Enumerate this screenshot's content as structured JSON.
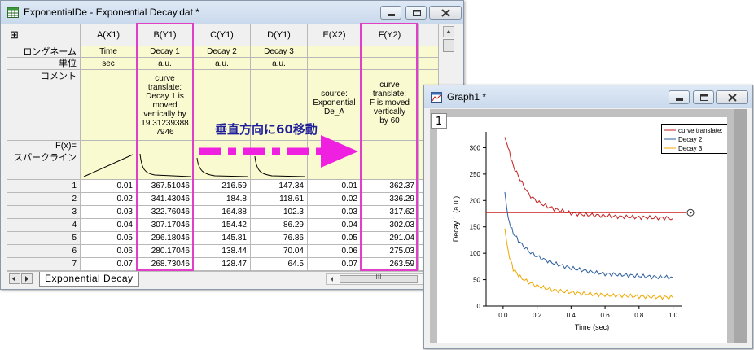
{
  "worksheet": {
    "title": "ExponentialDe - Exponential Decay.dat *",
    "corner_glyph": "⊞",
    "columns": [
      "A(X1)",
      "B(Y1)",
      "C(Y1)",
      "D(Y1)",
      "E(X2)",
      "F(Y2)"
    ],
    "row_labels": {
      "longname": "ロングネーム",
      "units": "単位",
      "comments": "コメント",
      "fx": "F(x)=",
      "sparkline": "スパークライン"
    },
    "longnames": [
      "Time",
      "Decay 1",
      "Decay 2",
      "Decay 3",
      "",
      ""
    ],
    "units": [
      "sec",
      "a.u.",
      "a.u.",
      "a.u.",
      "",
      ""
    ],
    "comments": [
      [],
      [
        "curve",
        "translate:",
        "Decay 1 is",
        "moved",
        "vertically by",
        "19.31239388",
        "7946"
      ],
      [],
      [],
      [
        "source:",
        "Exponential",
        "De_A"
      ],
      [
        "curve",
        "translate:",
        "F is moved",
        "vertically",
        "by 60"
      ]
    ],
    "rows": [
      {
        "n": "1",
        "cells": [
          "0.01",
          "367.51046",
          "216.59",
          "147.34",
          "0.01",
          "362.37"
        ]
      },
      {
        "n": "2",
        "cells": [
          "0.02",
          "341.43046",
          "184.8",
          "118.61",
          "0.02",
          "336.29"
        ]
      },
      {
        "n": "3",
        "cells": [
          "0.03",
          "322.76046",
          "164.88",
          "102.3",
          "0.03",
          "317.62"
        ]
      },
      {
        "n": "4",
        "cells": [
          "0.04",
          "307.17046",
          "154.42",
          "86.29",
          "0.04",
          "302.03"
        ]
      },
      {
        "n": "5",
        "cells": [
          "0.05",
          "296.18046",
          "145.81",
          "76.86",
          "0.05",
          "291.04"
        ]
      },
      {
        "n": "6",
        "cells": [
          "0.06",
          "280.17046",
          "138.44",
          "70.04",
          "0.06",
          "275.03"
        ]
      },
      {
        "n": "7",
        "cells": [
          "0.07",
          "268.73046",
          "128.47",
          "64.5",
          "0.07",
          "263.59"
        ]
      }
    ],
    "sheet_tab": "Exponential Decay",
    "hscroll_glyph": "III"
  },
  "annotation": {
    "text": "垂直方向に60移動",
    "text_color": "#1f1f9a",
    "arrow_color": "#f020e0"
  },
  "highlight_color": "#e040c8",
  "graph": {
    "title": "Graph1 *",
    "layer": "1",
    "chart_data": {
      "type": "line",
      "xlabel": "Time (sec)",
      "ylabel": "Decay 1 (a.u.)",
      "xlim": [
        -0.1,
        1.05
      ],
      "ylim": [
        0,
        330
      ],
      "x_ticks": [
        "0.0",
        "0.2",
        "0.4",
        "0.6",
        "0.8",
        "1.0"
      ],
      "y_ticks": [
        "0",
        "50",
        "100",
        "150",
        "200",
        "250",
        "300"
      ],
      "legend_position": "top-right",
      "hline": {
        "y": 177,
        "color": "#cc1f1f"
      },
      "series": [
        {
          "name": "curve translate:",
          "color": "#c41e1e",
          "x": [
            0.01,
            0.03,
            0.06,
            0.1,
            0.15,
            0.2,
            0.25,
            0.3,
            0.35,
            0.4,
            0.45,
            0.5,
            0.55,
            0.6,
            0.65,
            0.7,
            0.75,
            0.8,
            0.85,
            0.9,
            0.95,
            1.0
          ],
          "y": [
            320,
            300,
            265,
            240,
            212,
            198,
            190,
            184,
            180,
            176,
            174,
            173,
            172,
            171,
            170,
            169,
            169,
            168,
            168,
            167,
            167,
            166
          ]
        },
        {
          "name": "Decay 2",
          "color": "#2f5f9e",
          "x": [
            0.01,
            0.03,
            0.06,
            0.1,
            0.15,
            0.2,
            0.25,
            0.3,
            0.35,
            0.4,
            0.45,
            0.5,
            0.55,
            0.6,
            0.65,
            0.7,
            0.75,
            0.8,
            0.85,
            0.9,
            0.95,
            1.0
          ],
          "y": [
            216,
            165,
            138,
            120,
            104,
            94,
            87,
            81,
            76,
            72,
            69,
            66,
            63,
            61,
            60,
            59,
            58,
            57,
            56,
            55,
            55,
            54
          ]
        },
        {
          "name": "Decay 3",
          "color": "#f0a800",
          "x": [
            0.01,
            0.03,
            0.06,
            0.1,
            0.15,
            0.2,
            0.25,
            0.3,
            0.35,
            0.4,
            0.45,
            0.5,
            0.55,
            0.6,
            0.65,
            0.7,
            0.75,
            0.8,
            0.85,
            0.9,
            0.95,
            1.0
          ],
          "y": [
            147,
            102,
            70,
            55,
            45,
            38,
            34,
            30,
            28,
            26,
            24,
            23,
            22,
            21,
            20,
            20,
            19,
            18,
            18,
            17,
            17,
            16
          ]
        }
      ]
    }
  }
}
